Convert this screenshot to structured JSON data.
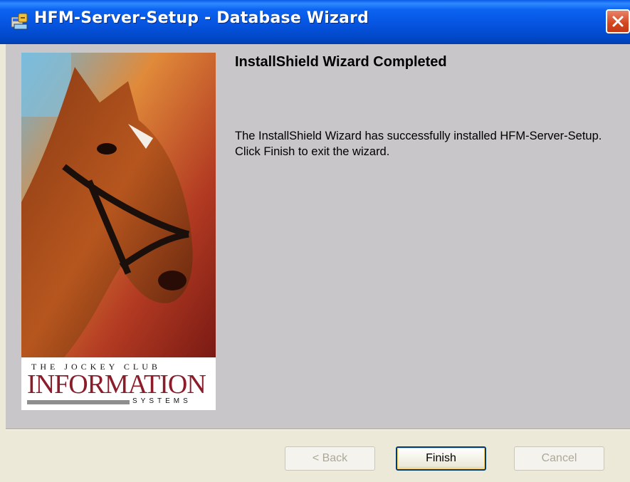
{
  "window": {
    "title": "HFM-Server-Setup - Database Wizard",
    "icon": "installer-icon",
    "close_icon": "close-icon"
  },
  "main": {
    "heading": "InstallShield Wizard Completed",
    "body": "The InstallShield Wizard has successfully installed HFM-Server-Setup. Click Finish to exit the wizard."
  },
  "side_image": {
    "subject": "horse-portrait",
    "logo_line1": "THE JOCKEY CLUB",
    "logo_line2": "INFORMATION",
    "logo_line3": "SYSTEMS"
  },
  "buttons": {
    "back": "< Back",
    "finish": "Finish",
    "cancel": "Cancel"
  },
  "colors": {
    "titlebar": "#0054e3",
    "content_bg": "#c8c6c8",
    "footer_bg": "#ece9d8",
    "close_button": "#d4461f"
  }
}
